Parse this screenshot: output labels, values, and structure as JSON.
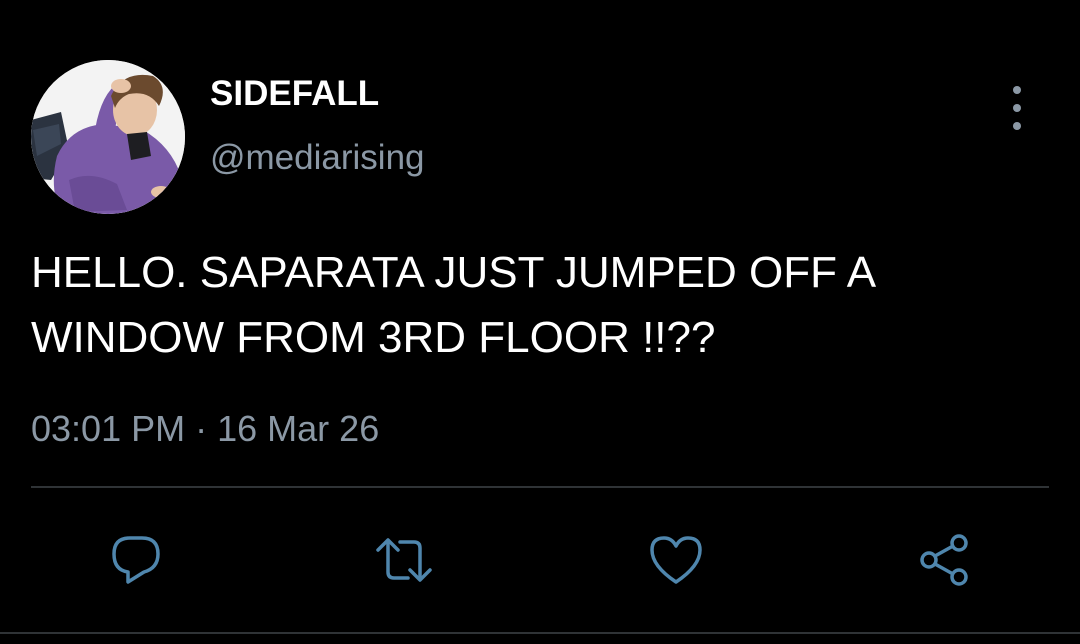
{
  "user": {
    "display_name": "SIDEFALL",
    "handle": "@mediarising",
    "avatar_icon": "profile-photo"
  },
  "tweet": {
    "text": "HELLO. SAPARATA JUST JUMPED OFF A WINDOW FROM 3RD FLOOR !!??",
    "time": "03:01 PM",
    "separator": "·",
    "date": "16 Mar 26"
  },
  "actions": {
    "icons": [
      "reply-icon",
      "retweet-icon",
      "like-icon",
      "share-icon"
    ],
    "icon_color": "#4f86ad"
  },
  "colors": {
    "background": "#000000",
    "text": "#ffffff",
    "secondary_text": "#8b98a5",
    "divider": "#2f3336"
  }
}
